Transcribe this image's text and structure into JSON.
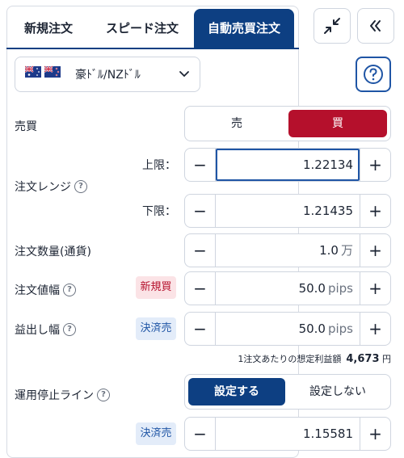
{
  "tabs": [
    "新規注文",
    "スピード注文",
    "自動売買注文"
  ],
  "pair": {
    "label": "豪ﾄﾞﾙ/NZﾄﾞﾙ"
  },
  "trade_side": {
    "label": "売買",
    "sell": "売",
    "buy": "買",
    "selected": "買"
  },
  "order_range": {
    "label": "注文レンジ",
    "upper_label": "上限：",
    "upper_value": "1.22134",
    "lower_label": "下限：",
    "lower_value": "1.21435"
  },
  "quantity": {
    "label": "注文数量(通貨)",
    "value": "1.0",
    "unit": "万"
  },
  "order_width": {
    "label": "注文値幅",
    "badge": "新規買",
    "value": "50.0",
    "unit": "pips"
  },
  "profit_width": {
    "label": "益出し幅",
    "badge": "決済売",
    "value": "50.0",
    "unit": "pips"
  },
  "expected_profit": {
    "label": "1注文あたりの想定利益額",
    "value": "4,673",
    "unit": "円"
  },
  "stop_line": {
    "label": "運用停止ライン",
    "on": "設定する",
    "off": "設定しない",
    "selected": "設定する",
    "badge": "決済売",
    "value": "1.15581"
  },
  "stepper_minus": "−",
  "stepper_plus": "+",
  "colors": {
    "primary": "#0d3f82",
    "buy": "#b5102c",
    "accent": "#1f55a5"
  },
  "icons": [
    "collapse-icon",
    "chevron-double-left-icon",
    "chevron-down-icon",
    "help-circle-icon",
    "au-flag-icon",
    "nz-flag-icon"
  ]
}
